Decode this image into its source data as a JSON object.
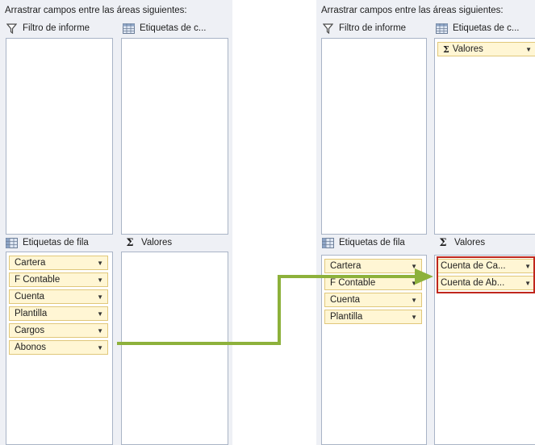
{
  "left_panel": {
    "instruction": "Arrastrar campos entre las áreas siguientes:",
    "filter_label": "Filtro de informe",
    "column_label": "Etiquetas de c...",
    "row_label": "Etiquetas de fila",
    "values_label": "Valores",
    "row_fields": [
      "Cartera",
      "F Contable",
      "Cuenta",
      "Plantilla",
      "Cargos",
      "Abonos"
    ]
  },
  "right_panel": {
    "instruction": "Arrastrar campos entre las áreas siguientes:",
    "filter_label": "Filtro de informe",
    "column_label": "Etiquetas de c...",
    "column_field": "Valores",
    "row_label": "Etiquetas de fila",
    "values_label": "Valores",
    "row_fields": [
      "Cartera",
      "F Contable",
      "Cuenta",
      "Plantilla"
    ],
    "value_fields": [
      "Cuenta de Ca...",
      "Cuenta de Ab..."
    ]
  },
  "icons": {
    "filter": "funnel-icon",
    "columns": "grid-icon",
    "rows": "grid-icon",
    "values": "sigma-icon",
    "dropdown": "triangle-down-icon",
    "arrow": "green-arrow"
  },
  "colors": {
    "field_bg": "#fff6d4",
    "highlight": "#c0261c",
    "arrow": "#8db13b"
  }
}
